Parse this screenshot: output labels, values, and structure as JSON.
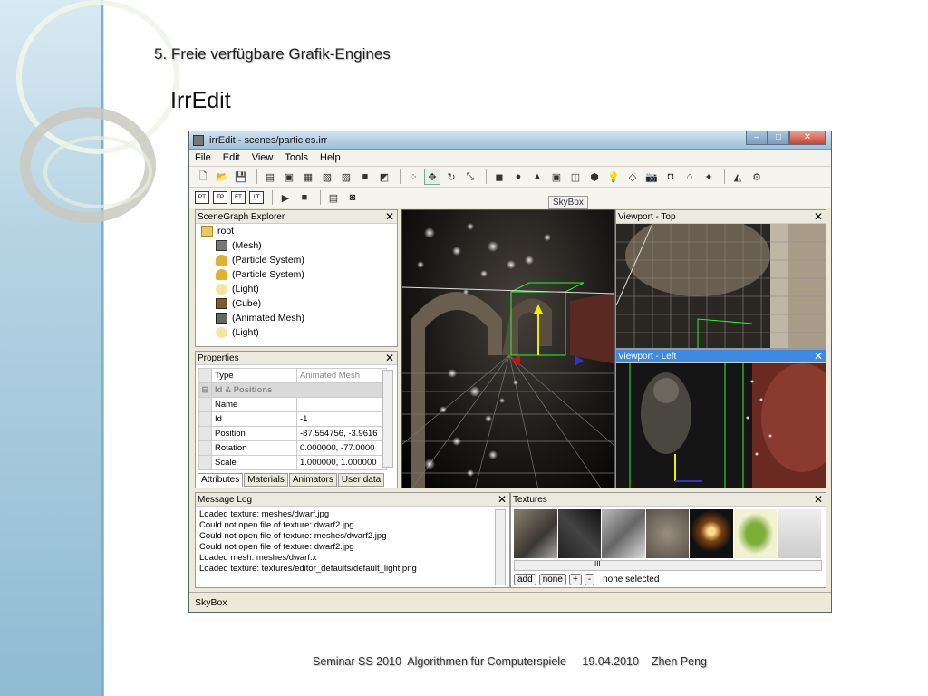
{
  "slide": {
    "title": "5. Freie verfügbare Grafik-Engines",
    "subtitle": "IrrEdit",
    "footer": "Seminar SS 2010  Algorithmen für Computerspiele     19.04.2010    Zhen Peng"
  },
  "window": {
    "title": "irrEdit - scenes/particles.irr",
    "controls": {
      "minimize": "–",
      "maximize": "□",
      "close": "✕"
    }
  },
  "menu": [
    "File",
    "Edit",
    "View",
    "Tools",
    "Help"
  ],
  "toolbar2": [
    "PT",
    "TP",
    "FT",
    "LT"
  ],
  "tooltip": "SkyBox",
  "scenegraph": {
    "title": "SceneGraph Explorer",
    "root": "root",
    "items": [
      "(Mesh)",
      "(Particle System)",
      "(Particle System)",
      "(Light)",
      "(Cube)",
      "(Animated Mesh)",
      "(Light)"
    ]
  },
  "properties": {
    "title": "Properties",
    "type_label": "Type",
    "type_value": "Animated Mesh",
    "group_label": "Id & Positions",
    "group_symbol": "⊟",
    "rows": [
      {
        "k": "Name",
        "v": ""
      },
      {
        "k": "Id",
        "v": "-1"
      },
      {
        "k": "Position",
        "v": "-87.554756, -3.9616"
      },
      {
        "k": "Rotation",
        "v": "0.000000, -77.0000"
      },
      {
        "k": "Scale",
        "v": "1.000000, 1.000000"
      }
    ],
    "tabs": [
      "Attributes",
      "Materials",
      "Animators",
      "User data"
    ]
  },
  "viewports": {
    "top": "Viewport - Top",
    "left": "Viewport - Left"
  },
  "messagelog": {
    "title": "Message Log",
    "lines": [
      "Loaded texture: meshes/dwarf.jpg",
      "Could not open file of texture: dwarf2.jpg",
      "Could not open file of texture: meshes/dwarf2.jpg",
      "Could not open file of texture: dwarf2.jpg",
      "Loaded mesh: meshes/dwarf.x",
      "Loaded texture: textures/editor_defaults/default_light.png"
    ]
  },
  "textures": {
    "title": "Textures",
    "buttons": [
      "add",
      "none",
      "+",
      "-"
    ],
    "status": "none selected",
    "scroll_label": "III"
  },
  "statusbar": {
    "text": "SkyBox"
  },
  "close_glyph": "✕"
}
